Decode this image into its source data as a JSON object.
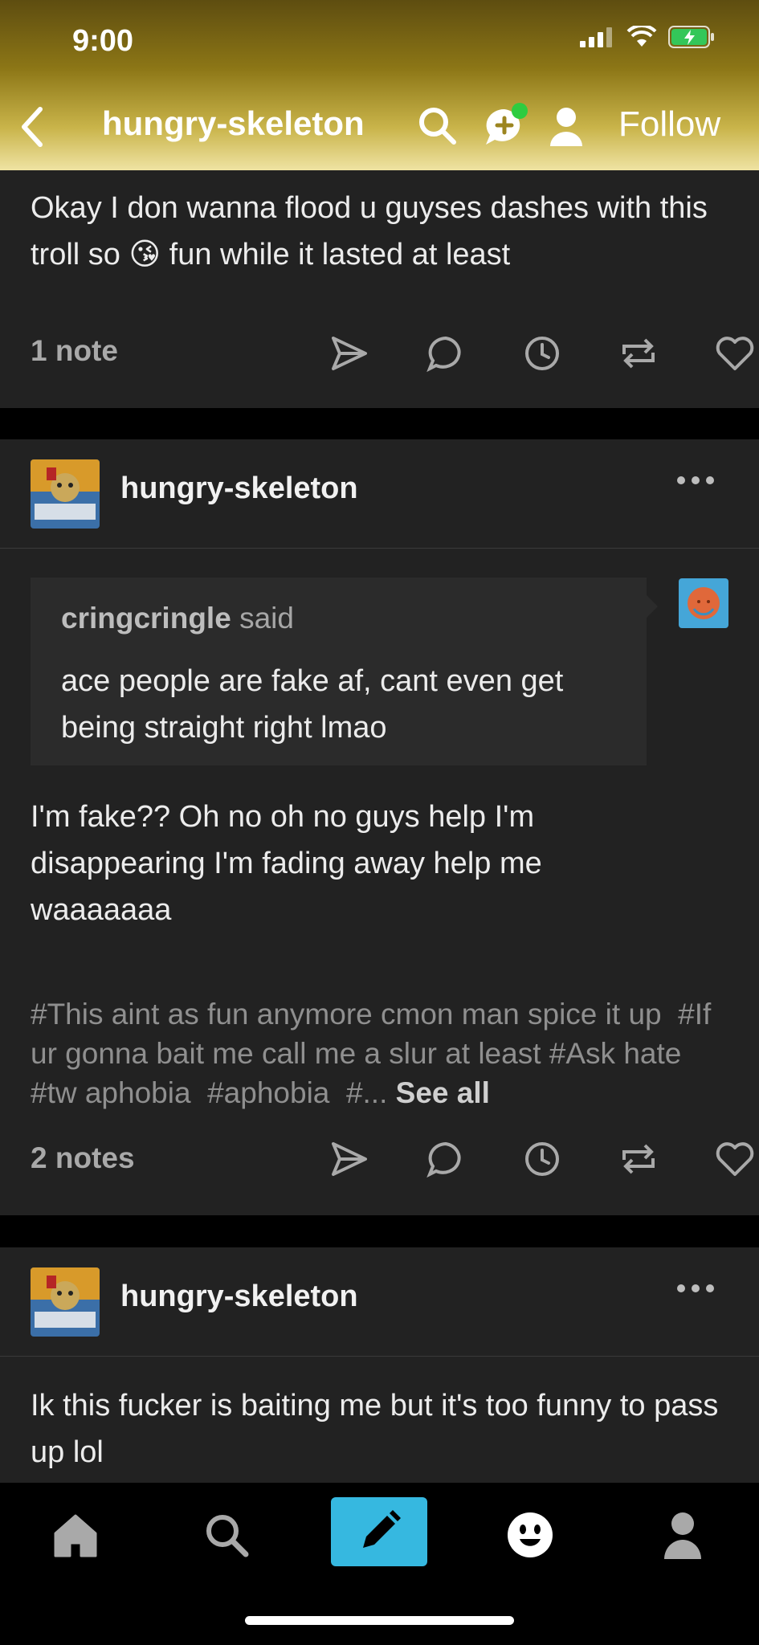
{
  "status_bar": {
    "time": "9:00"
  },
  "nav": {
    "blog_title": "hungry-skeleton",
    "follow_label": "Follow"
  },
  "posts": [
    {
      "body": "Okay I don wanna flood u guyses dashes with this troll so 😘 fun while it lasted at least",
      "notes": "1 note"
    },
    {
      "blog": "hungry-skeleton",
      "asker": "cringcringle",
      "said": "said",
      "question": "ace people are fake af, cant even get being straight right lmao",
      "body": "I'm fake?? Oh no oh no guys help I'm disappearing I'm fading away help me waaaaaaa",
      "tags": [
        "#This aint as fun anymore cmon man spice it up",
        "#If ur gonna bait me call me a slur at least",
        "#Ask hate",
        "#tw aphobia",
        "#aphobia",
        "#..."
      ],
      "see_all": "See all",
      "notes": "2 notes"
    },
    {
      "blog": "hungry-skeleton",
      "body": "Ik this fucker is baiting me but it's too funny to pass up lol"
    }
  ],
  "action_icons": [
    "share-icon",
    "reply-icon",
    "queue-icon",
    "reblog-icon",
    "like-icon"
  ],
  "tab_bar": [
    "home-icon",
    "search-icon",
    "compose-icon",
    "activity-icon",
    "account-icon"
  ],
  "colors": {
    "accent": "#36b8e0",
    "card": "#222222",
    "background": "#000000",
    "online_dot": "#2ecc40"
  }
}
